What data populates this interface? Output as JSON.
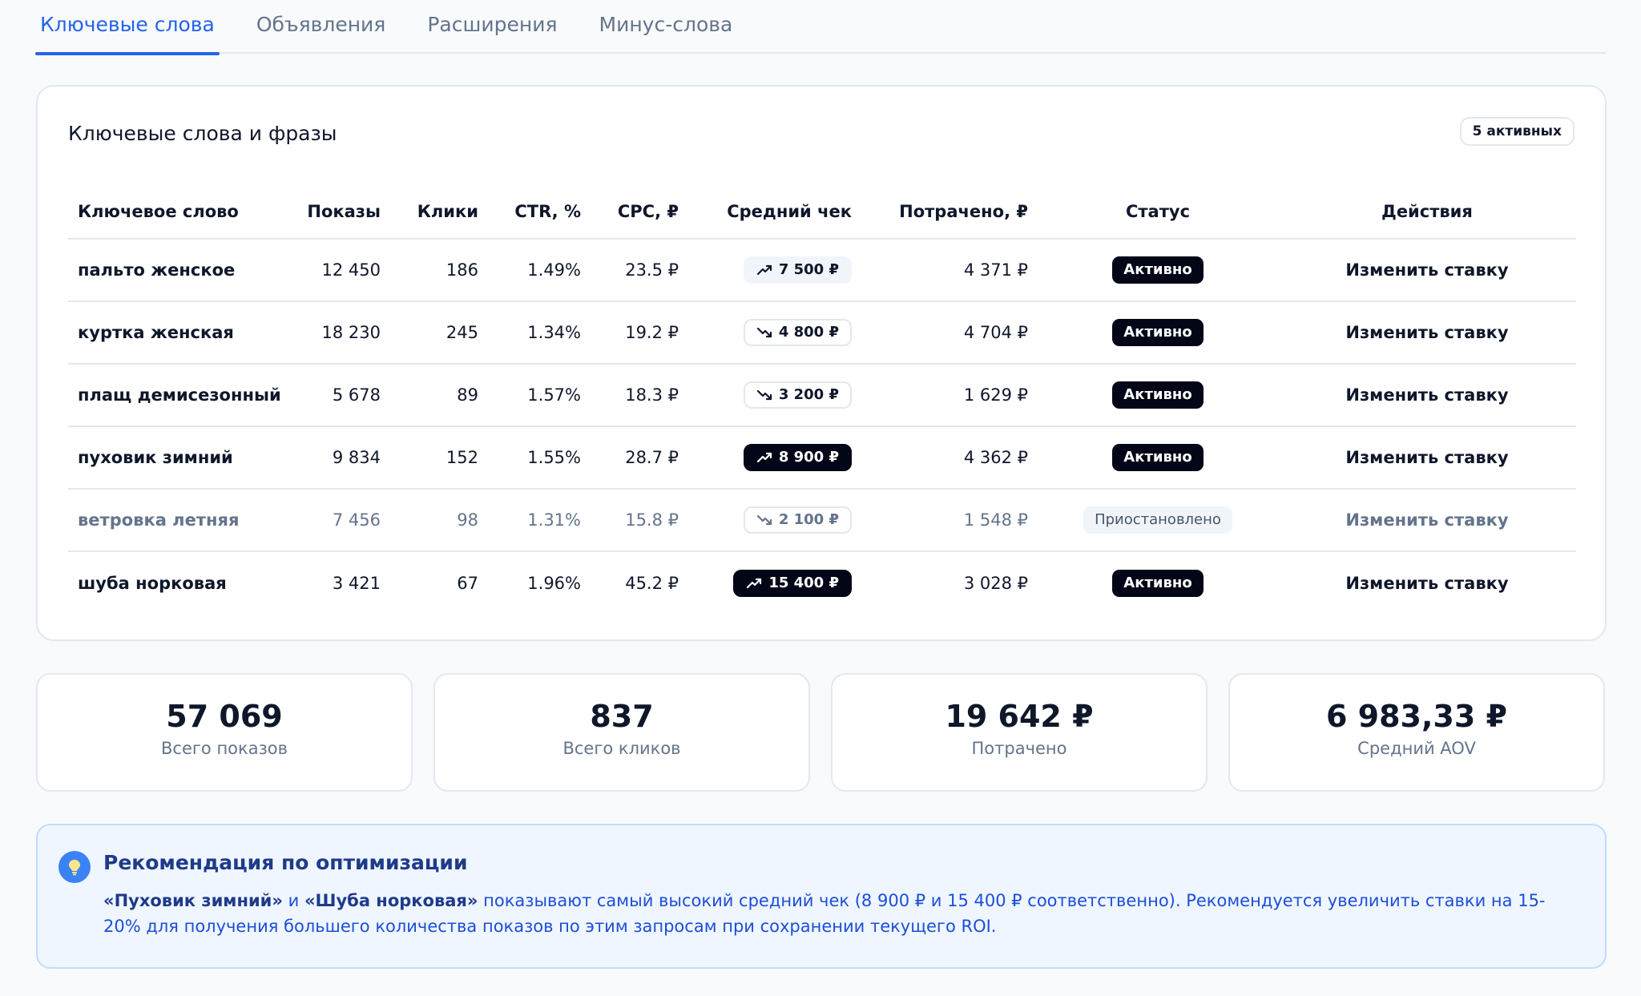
{
  "tabs": [
    {
      "label": "Ключевые слова",
      "active": true
    },
    {
      "label": "Объявления",
      "active": false
    },
    {
      "label": "Расширения",
      "active": false
    },
    {
      "label": "Минус-слова",
      "active": false
    }
  ],
  "keywords_card": {
    "title": "Ключевые слова и фразы",
    "badge": "5 активных",
    "columns": {
      "keyword": "Ключевое слово",
      "impressions": "Показы",
      "clicks": "Клики",
      "ctr": "CTR, %",
      "cpc": "CPC, ₽",
      "aov": "Средний чек",
      "spent": "Потрачено, ₽",
      "status": "Статус",
      "actions": "Действия"
    },
    "rows": [
      {
        "keyword": "пальто женское",
        "impressions": "12 450",
        "clicks": "186",
        "ctr": "1.49%",
        "cpc": "23.5 ₽",
        "aov": "7 500 ₽",
        "trend": "up",
        "aov_style": "light",
        "spent": "4 371 ₽",
        "status": "Активно",
        "status_type": "active",
        "action": "Изменить ставку"
      },
      {
        "keyword": "куртка женская",
        "impressions": "18 230",
        "clicks": "245",
        "ctr": "1.34%",
        "cpc": "19.2 ₽",
        "aov": "4 800 ₽",
        "trend": "down",
        "aov_style": "outline",
        "spent": "4 704 ₽",
        "status": "Активно",
        "status_type": "active",
        "action": "Изменить ставку"
      },
      {
        "keyword": "плащ демисезонный",
        "impressions": "5 678",
        "clicks": "89",
        "ctr": "1.57%",
        "cpc": "18.3 ₽",
        "aov": "3 200 ₽",
        "trend": "down",
        "aov_style": "outline",
        "spent": "1 629 ₽",
        "status": "Активно",
        "status_type": "active",
        "action": "Изменить ставку"
      },
      {
        "keyword": "пуховик зимний",
        "impressions": "9 834",
        "clicks": "152",
        "ctr": "1.55%",
        "cpc": "28.7 ₽",
        "aov": "8 900 ₽",
        "trend": "up",
        "aov_style": "dark",
        "spent": "4 362 ₽",
        "status": "Активно",
        "status_type": "active",
        "action": "Изменить ставку"
      },
      {
        "keyword": "ветровка летняя",
        "impressions": "7 456",
        "clicks": "98",
        "ctr": "1.31%",
        "cpc": "15.8 ₽",
        "aov": "2 100 ₽",
        "trend": "down",
        "aov_style": "outline-muted",
        "spent": "1 548 ₽",
        "status": "Приостановлено",
        "status_type": "paused",
        "action": "Изменить ставку"
      },
      {
        "keyword": "шуба норковая",
        "impressions": "3 421",
        "clicks": "67",
        "ctr": "1.96%",
        "cpc": "45.2 ₽",
        "aov": "15 400 ₽",
        "trend": "up",
        "aov_style": "dark",
        "spent": "3 028 ₽",
        "status": "Активно",
        "status_type": "active",
        "action": "Изменить ставку"
      }
    ]
  },
  "stats": [
    {
      "value": "57 069",
      "label": "Всего показов"
    },
    {
      "value": "837",
      "label": "Всего кликов"
    },
    {
      "value": "19 642 ₽",
      "label": "Потрачено"
    },
    {
      "value": "6 983,33 ₽",
      "label": "Средний AOV"
    }
  ],
  "recommendation": {
    "icon": "lightbulb-icon",
    "title": "Рекомендация по оптимизации",
    "kw1": "«Пуховик зимний»",
    "connector": " и ",
    "kw2": "«Шуба норковая»",
    "text": " показывают самый высокий средний чек (8 900 ₽ и 15 400 ₽ соответственно). Рекомендуется увеличить ставки на 15-20% для получения большего количества показов по этим запросам при сохранении текущего ROI."
  },
  "colors": {
    "accent": "#2563eb",
    "dark_badge": "#020617",
    "muted_text": "#64748b",
    "reco_bg": "#eff6ff"
  }
}
